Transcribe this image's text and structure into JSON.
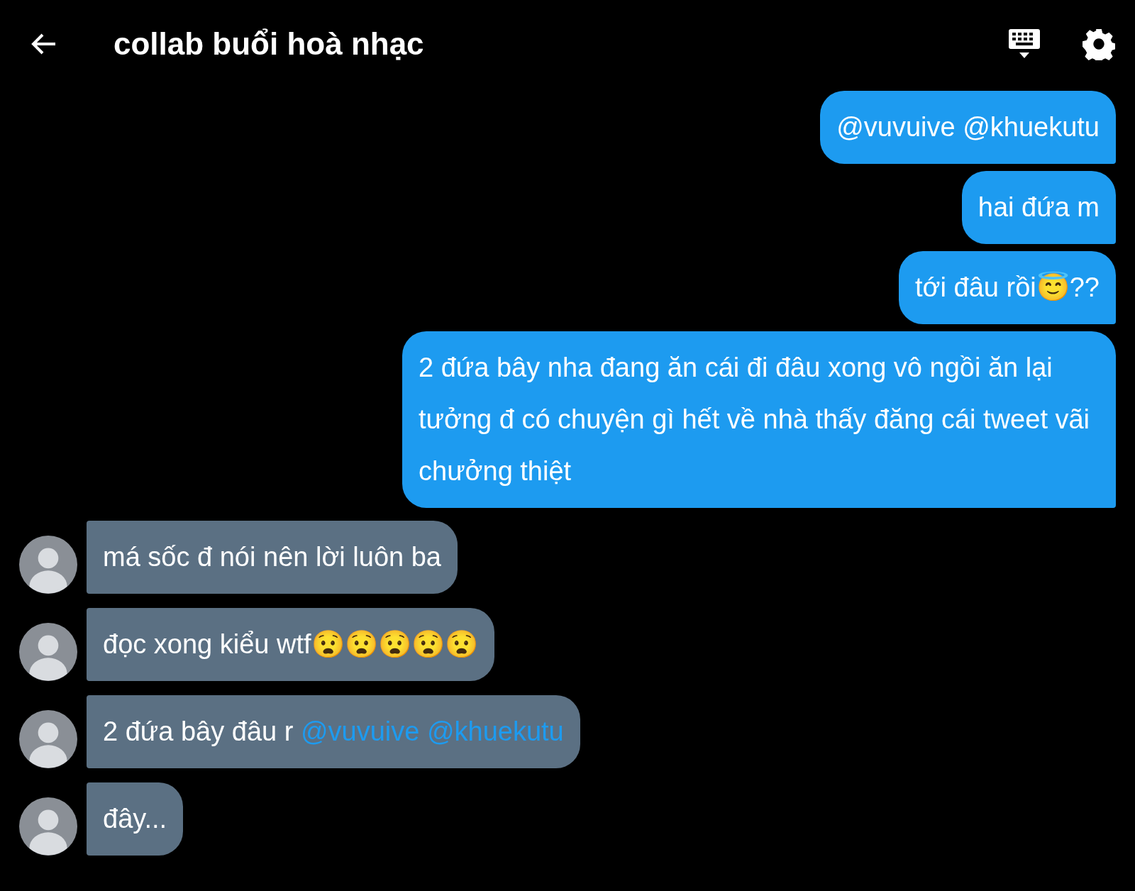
{
  "header": {
    "title": "collab buổi hoà nhạc"
  },
  "messages": [
    {
      "kind": "outgoing",
      "parts": [
        {
          "kind": "text",
          "text": "@vuvuive @khuekutu"
        }
      ]
    },
    {
      "kind": "outgoing",
      "parts": [
        {
          "kind": "text",
          "text": "hai đứa m"
        }
      ]
    },
    {
      "kind": "outgoing",
      "parts": [
        {
          "kind": "text",
          "text": "tới đâu rồi😇??"
        }
      ]
    },
    {
      "kind": "outgoing",
      "parts": [
        {
          "kind": "text",
          "text": "2 đứa bây nha đang ăn cái đi đâu xong vô ngồi ăn lại tưởng đ có chuyện gì hết về nhà thấy đăng cái tweet vãi chưởng thiệt"
        }
      ]
    },
    {
      "kind": "incoming",
      "parts": [
        {
          "kind": "text",
          "text": "má sốc đ nói nên lời luôn ba"
        }
      ]
    },
    {
      "kind": "incoming",
      "parts": [
        {
          "kind": "text",
          "text": "đọc xong kiểu wtf😧😧😧😧😧"
        }
      ]
    },
    {
      "kind": "incoming",
      "parts": [
        {
          "kind": "text",
          "text": "2 đứa bây đâu r "
        },
        {
          "kind": "mention",
          "text": "@vuvuive @khuekutu"
        }
      ]
    },
    {
      "kind": "incoming",
      "parts": [
        {
          "kind": "text",
          "text": "đây..."
        }
      ]
    }
  ]
}
